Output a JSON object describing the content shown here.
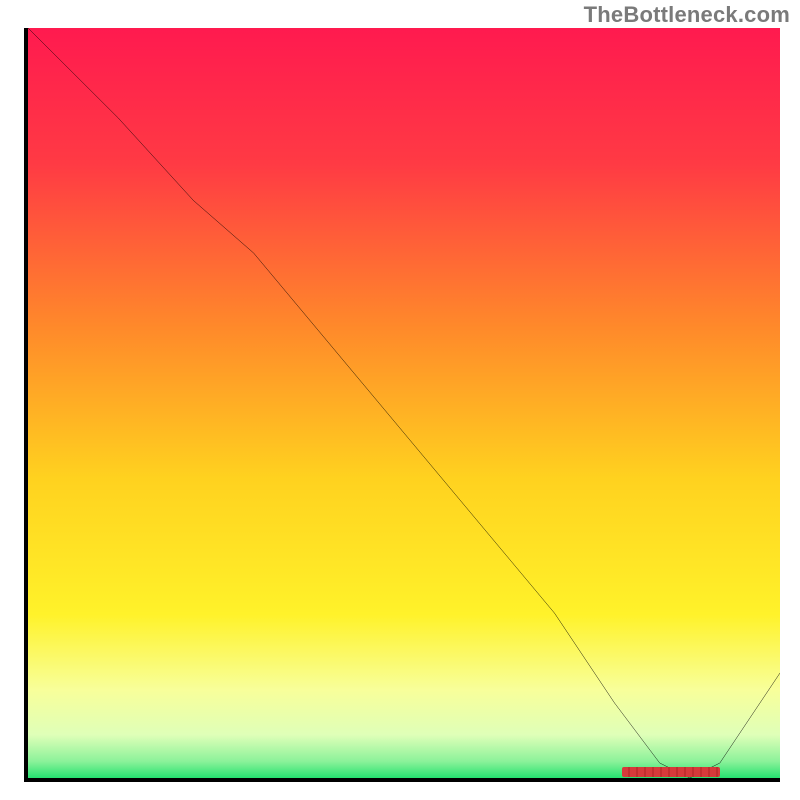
{
  "watermark": "TheBottleneck.com",
  "chart_data": {
    "type": "line",
    "title": "",
    "xlabel": "",
    "ylabel": "",
    "xlim": [
      0,
      100
    ],
    "ylim": [
      0,
      100
    ],
    "grid": false,
    "legend": false,
    "series": [
      {
        "name": "curve",
        "x": [
          0,
          12,
          22,
          30,
          40,
          50,
          60,
          70,
          78,
          84,
          88,
          92,
          100
        ],
        "y": [
          100,
          88,
          77,
          70,
          58,
          46,
          34,
          22,
          10,
          2,
          0,
          2,
          14
        ]
      }
    ],
    "highlight_segment": {
      "x_start": 79,
      "x_end": 92,
      "y": 0
    },
    "background_gradient_stops": [
      {
        "offset": 0,
        "color": "#ff1a4f"
      },
      {
        "offset": 0.18,
        "color": "#ff3a44"
      },
      {
        "offset": 0.4,
        "color": "#ff8a2a"
      },
      {
        "offset": 0.6,
        "color": "#ffd21f"
      },
      {
        "offset": 0.78,
        "color": "#fff22a"
      },
      {
        "offset": 0.88,
        "color": "#f8ff9a"
      },
      {
        "offset": 0.94,
        "color": "#dfffb8"
      },
      {
        "offset": 0.975,
        "color": "#8cf29a"
      },
      {
        "offset": 1.0,
        "color": "#19e06a"
      }
    ]
  }
}
